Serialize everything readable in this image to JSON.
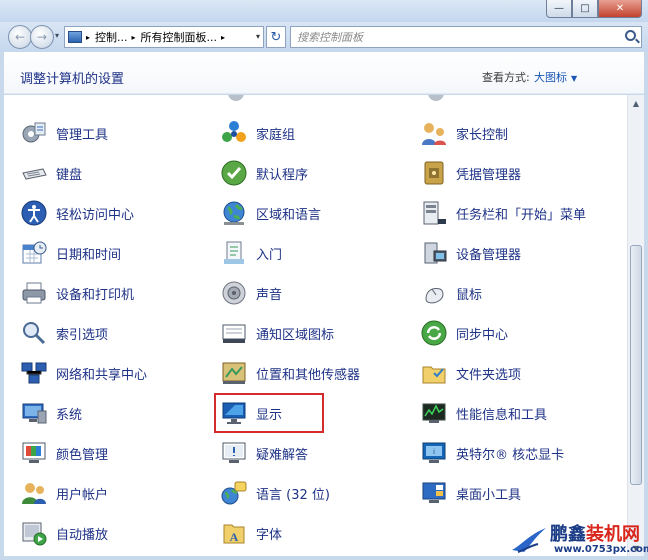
{
  "window": {
    "minimize": "—",
    "maximize": "□",
    "close": "✕"
  },
  "nav": {
    "back": "←",
    "forward": "→",
    "dropdown": "▾",
    "breadcrumbs": [
      "控制...",
      "所有控制面板..."
    ],
    "refresh": "↻",
    "search_placeholder": "搜索控制面板"
  },
  "header": {
    "title": "调整计算机的设置",
    "view_label": "查看方式:",
    "view_value": "大图标"
  },
  "items": [
    [
      {
        "label": "管理工具",
        "icon": "admin-tools-icon"
      },
      {
        "label": "家庭组",
        "icon": "homegroup-icon"
      },
      {
        "label": "家长控制",
        "icon": "parental-controls-icon"
      }
    ],
    [
      {
        "label": "键盘",
        "icon": "keyboard-icon"
      },
      {
        "label": "默认程序",
        "icon": "default-programs-icon"
      },
      {
        "label": "凭据管理器",
        "icon": "credential-manager-icon"
      }
    ],
    [
      {
        "label": "轻松访问中心",
        "icon": "ease-of-access-icon"
      },
      {
        "label": "区域和语言",
        "icon": "region-language-icon"
      },
      {
        "label": "任务栏和「开始」菜单",
        "icon": "taskbar-icon"
      }
    ],
    [
      {
        "label": "日期和时间",
        "icon": "date-time-icon"
      },
      {
        "label": "入门",
        "icon": "getting-started-icon"
      },
      {
        "label": "设备管理器",
        "icon": "device-manager-icon"
      }
    ],
    [
      {
        "label": "设备和打印机",
        "icon": "printer-icon"
      },
      {
        "label": "声音",
        "icon": "sound-icon"
      },
      {
        "label": "鼠标",
        "icon": "mouse-icon"
      }
    ],
    [
      {
        "label": "索引选项",
        "icon": "indexing-icon"
      },
      {
        "label": "通知区域图标",
        "icon": "notification-area-icon"
      },
      {
        "label": "同步中心",
        "icon": "sync-center-icon"
      }
    ],
    [
      {
        "label": "网络和共享中心",
        "icon": "network-icon"
      },
      {
        "label": "位置和其他传感器",
        "icon": "location-sensor-icon"
      },
      {
        "label": "文件夹选项",
        "icon": "folder-options-icon"
      }
    ],
    [
      {
        "label": "系统",
        "icon": "system-icon"
      },
      {
        "label": "显示",
        "icon": "display-icon"
      },
      {
        "label": "性能信息和工具",
        "icon": "performance-icon"
      }
    ],
    [
      {
        "label": "颜色管理",
        "icon": "color-management-icon"
      },
      {
        "label": "疑难解答",
        "icon": "troubleshooting-icon"
      },
      {
        "label": "英特尔® 核芯显卡",
        "icon": "intel-graphics-icon"
      }
    ],
    [
      {
        "label": "用户帐户",
        "icon": "user-accounts-icon"
      },
      {
        "label": "语言 (32 位)",
        "icon": "language-icon"
      },
      {
        "label": "桌面小工具",
        "icon": "gadgets-icon"
      }
    ],
    [
      {
        "label": "自动播放",
        "icon": "autoplay-icon"
      },
      {
        "label": "字体",
        "icon": "fonts-icon"
      }
    ]
  ],
  "watermark": {
    "brand_a": "鹏鑫",
    "brand_b": "装机网",
    "url": "www.0753px.com"
  },
  "colors": {
    "link": "#1e3287",
    "highlight": "#d52b2b"
  }
}
